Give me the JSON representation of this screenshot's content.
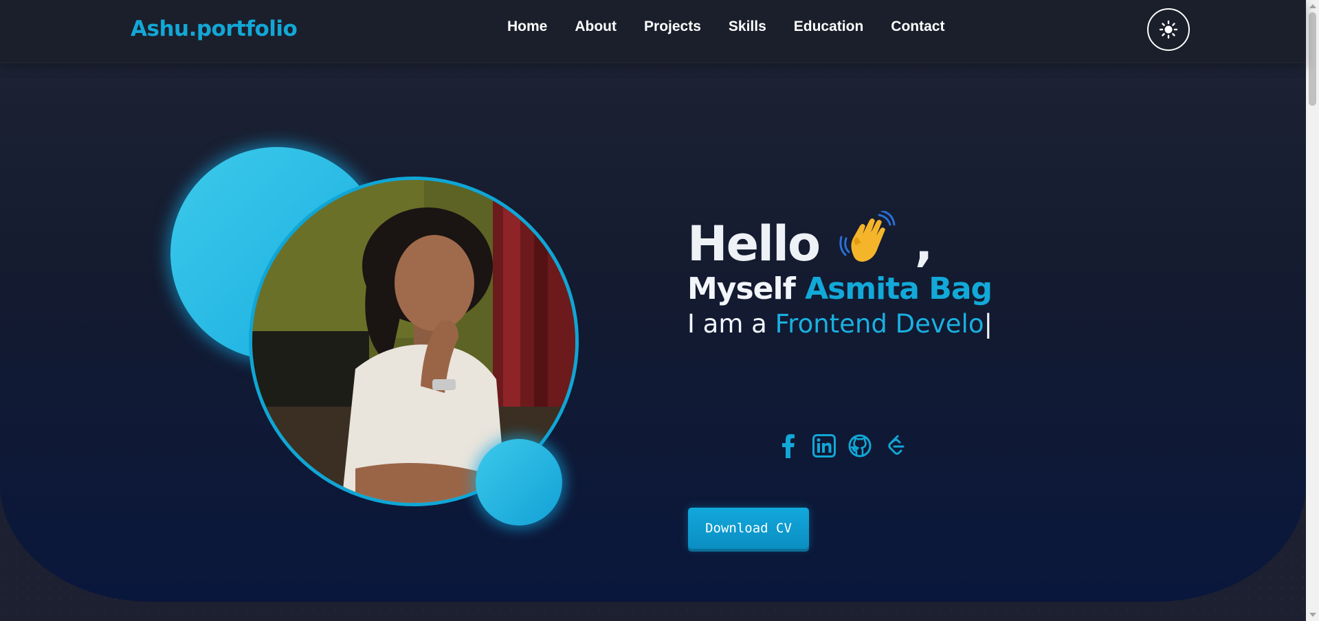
{
  "header": {
    "logo": "Ashu.portfolio",
    "nav": [
      "Home",
      "About",
      "Projects",
      "Skills",
      "Education",
      "Contact"
    ],
    "theme_toggle_icon": "sun-icon"
  },
  "hero": {
    "hello": "Hello",
    "hello_comma": ",",
    "wave_icon": "waving-hand-icon",
    "myself_prefix": "Myself",
    "name": "Asmita Bag",
    "role_prefix": "I am a",
    "role_typed": "Frontend Develo",
    "cursor": "|",
    "socials": [
      "facebook-icon",
      "linkedin-icon",
      "github-icon",
      "leetcode-icon"
    ],
    "cv_button": "Download CV"
  },
  "colors": {
    "accent": "#12a7d6",
    "background": "#1b1f2b",
    "hero_bottom": "#0a173c"
  }
}
